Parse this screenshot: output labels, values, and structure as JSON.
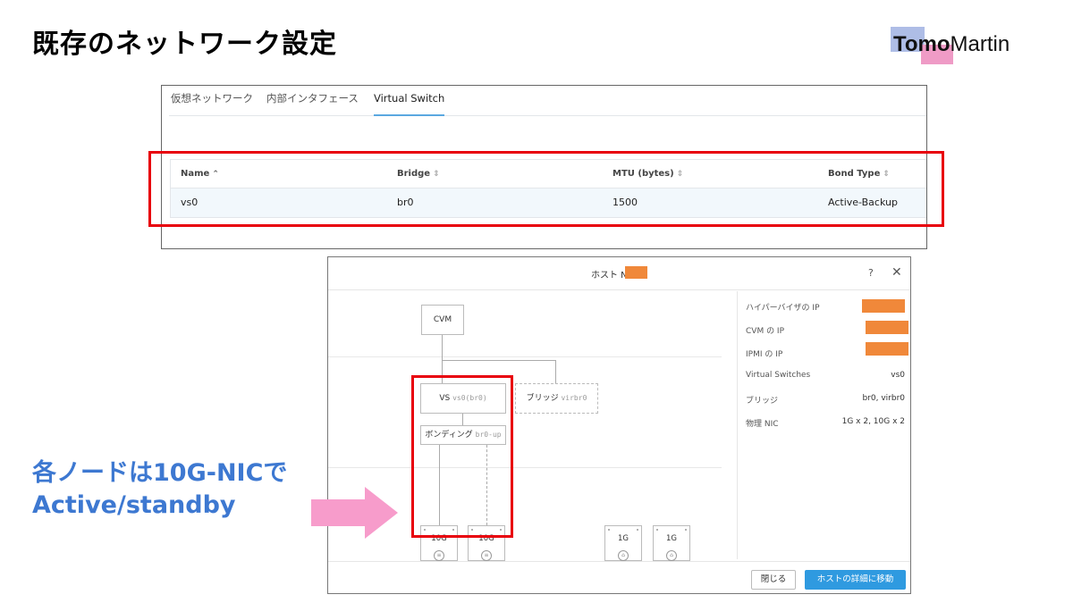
{
  "slide": {
    "title": "既存のネットワーク設定"
  },
  "logo": {
    "part1": "Tomo",
    "part2": "Martin"
  },
  "tabs": [
    {
      "label": "仮想ネットワーク",
      "active": false
    },
    {
      "label": "内部インタフェース",
      "active": false
    },
    {
      "label": "Virtual Switch",
      "active": true
    }
  ],
  "vs_table": {
    "columns": [
      "Name",
      "Bridge",
      "MTU (bytes)",
      "Bond Type"
    ],
    "sort_icons": [
      "⌃",
      "⇕",
      "⇕",
      "⇕"
    ],
    "rows": [
      {
        "name": "vs0",
        "bridge": "br0",
        "mtu": "1500",
        "bond_type": "Active-Backup"
      }
    ]
  },
  "dialog": {
    "title": "ホスト NX",
    "help": "?",
    "close": "✕",
    "diagram": {
      "cvm": "CVM",
      "vs_label": "VS",
      "vs_sub": "vs0(br0)",
      "bridge_label": "ブリッジ",
      "bridge_sub": "virbr0",
      "bond_label": "ボンディング",
      "bond_sub": "br0-up",
      "nics": [
        "10G",
        "10G",
        "1G",
        "1G"
      ]
    },
    "info": [
      {
        "key": "ハイパーバイザの IP",
        "value": "",
        "redacted": true
      },
      {
        "key": "CVM の IP",
        "value": "",
        "redacted": true
      },
      {
        "key": "IPMI の IP",
        "value": "",
        "redacted": true
      },
      {
        "key": "Virtual Switches",
        "value": "vs0"
      },
      {
        "key": "ブリッジ",
        "value": "br0, virbr0"
      },
      {
        "key": "物理 NIC",
        "value": "1G x 2, 10G x 2"
      }
    ],
    "buttons": {
      "close": "閉じる",
      "go": "ホストの詳細に移動"
    }
  },
  "callout": {
    "line1": "各ノードは10G-NICで",
    "line2": "Active/standby"
  },
  "colors": {
    "highlight": "#e8000b",
    "callout_text": "#3d78d1",
    "arrow": "#f79ccb",
    "redaction": "#f0883a",
    "primary_button": "#2f9ae0"
  }
}
